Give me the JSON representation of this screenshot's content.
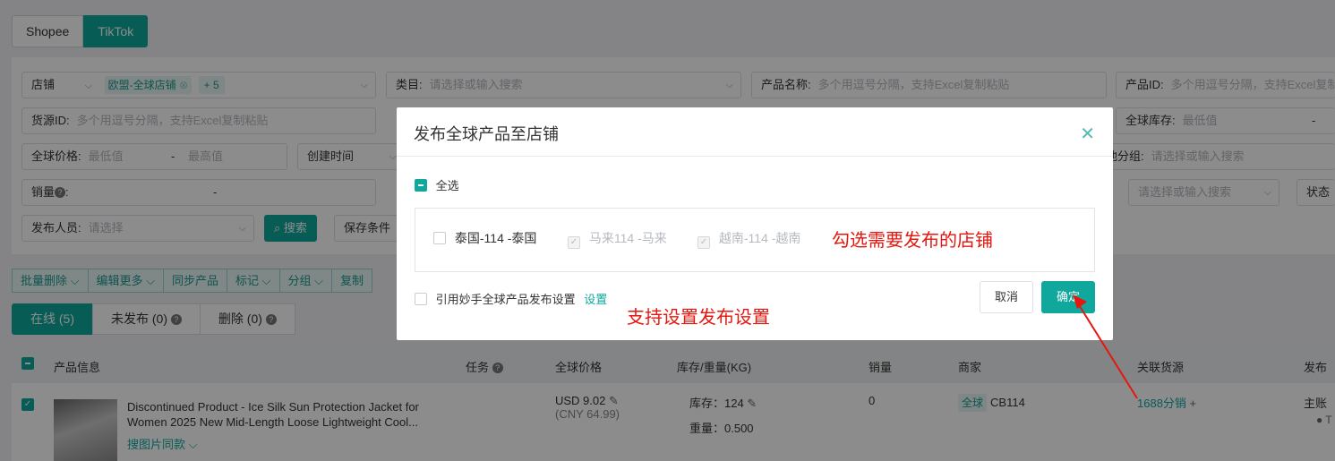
{
  "platform_tabs": [
    "Shopee",
    "TikTok"
  ],
  "filters": {
    "store_label": "店铺",
    "store_tag": "欧盟-全球店铺",
    "store_more": "+ 5",
    "category_label": "类目:",
    "category_placeholder": "请选择或输入搜索",
    "product_name_label": "产品名称:",
    "product_name_placeholder": "多个用逗号分隔，支持Excel复制粘贴",
    "product_id_label": "产品ID:",
    "product_id_placeholder": "多个用逗号分隔，支持Excel复制粘贴",
    "source_id_label": "货源ID:",
    "source_id_placeholder": "多个用逗号分隔，支持Excel复制粘贴",
    "global_stock_label": "全球库存:",
    "global_stock_min": "最低值",
    "global_price_label": "全球价格:",
    "global_price_min": "最低值",
    "global_price_max": "最高值",
    "range_sep": "-",
    "create_time_label": "创建时间",
    "group_label_fragment": "他分组:",
    "group_placeholder": "请选择或输入搜索",
    "sales_label": "销量",
    "sales_sep": "-",
    "dropdown_placeholder": "请选择或输入搜索",
    "status_label_fragment": "状态",
    "publisher_label": "发布人员:",
    "publisher_placeholder": "请选择",
    "search_button": "搜索",
    "save_button": "保存条件"
  },
  "bulk_actions": [
    "批量删除",
    "编辑更多",
    "同步产品",
    "标记",
    "分组",
    "复制"
  ],
  "status_tabs": [
    "在线 (5)",
    "未发布 (0)",
    "删除 (0)"
  ],
  "table": {
    "headers": [
      "产品信息",
      "任务",
      "全球价格",
      "库存/重量(KG)",
      "销量",
      "商家",
      "关联货源",
      "发布"
    ],
    "row": {
      "title_line1": "Discontinued Product - Ice Silk Sun Protection Jacket for",
      "title_line2": "Women 2025 New Mid-Length Loose Lightweight Cool...",
      "image_search": "搜图片同款",
      "price": "USD 9.02",
      "price_cny": "(CNY 64.99)",
      "stock": "库存：124",
      "weight": "重量：0.500",
      "sales": "0",
      "merchant_tag": "全球",
      "merchant": "CB114",
      "source": "1688分销",
      "publish_fragment": "主账"
    }
  },
  "modal": {
    "title": "发布全球产品至店铺",
    "select_all": "全选",
    "shops": [
      {
        "name": "泰国-114 -泰国",
        "state": "unchecked"
      },
      {
        "name": "马来114 -马来",
        "state": "disabled"
      },
      {
        "name": "越南-114 -越南",
        "state": "disabled"
      }
    ],
    "cite_setting_label": "引用妙手全球产品发布设置",
    "setting_link": "设置",
    "cancel": "取消",
    "confirm": "确定"
  },
  "annotations": {
    "shop_hint": "勾选需要发布的店铺",
    "setting_hint": "支持设置发布设置"
  },
  "colors": {
    "accent": "#10a89d",
    "annotation": "#e5170f"
  }
}
